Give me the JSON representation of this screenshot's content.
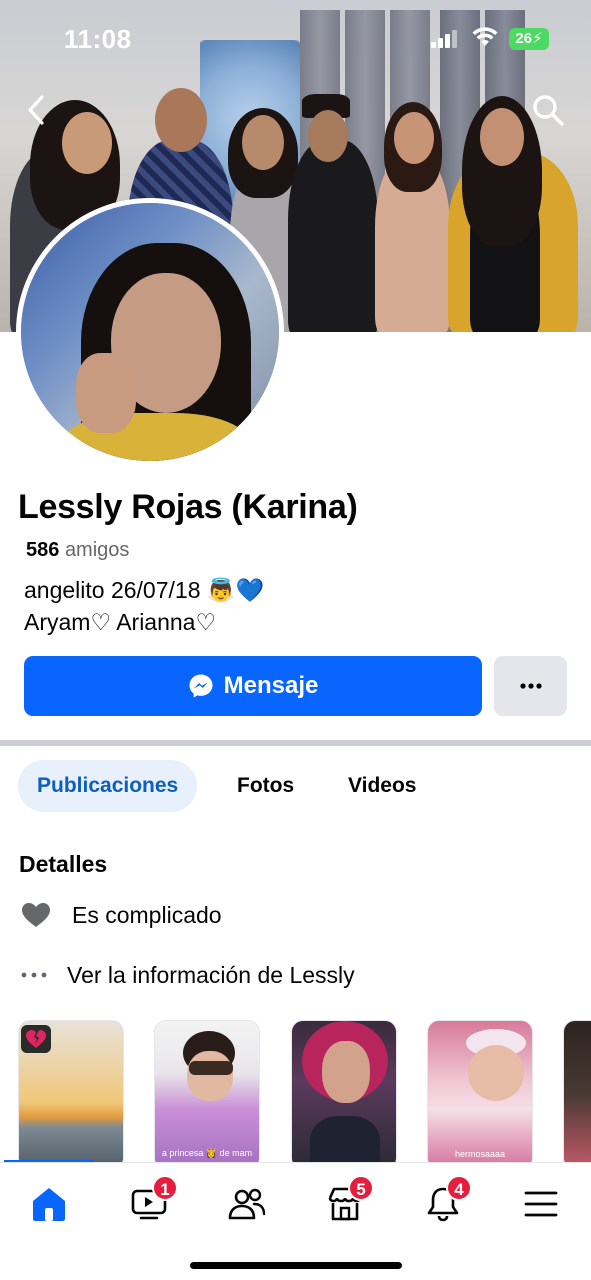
{
  "status_bar": {
    "time": "11:08",
    "battery": "26"
  },
  "header": {
    "back_icon": "chevron-left-icon",
    "search_icon": "search-icon"
  },
  "profile": {
    "name": "Lessly Rojas (Karina)",
    "friends_count": "586",
    "friends_label": "amigos",
    "bio_line1": "angelito 26/07/18 👼💙",
    "bio_line2": "Aryam♡ Arianna♡"
  },
  "actions": {
    "message_label": "Mensaje",
    "message_icon": "messenger-icon",
    "more_label": "···"
  },
  "tabs": [
    {
      "label": "Publicaciones",
      "active": true
    },
    {
      "label": "Fotos",
      "active": false
    },
    {
      "label": "Videos",
      "active": false
    }
  ],
  "details": {
    "title": "Detalles",
    "relationship": "Es complicado",
    "see_info": "Ver la información de Lessly"
  },
  "stories": [
    {
      "caption": ""
    },
    {
      "caption": "a princesa 👸 de mam"
    },
    {
      "caption": ""
    },
    {
      "caption": "hermosaaaa"
    },
    {
      "caption": ""
    }
  ],
  "navbar": {
    "items": [
      {
        "name": "home-icon",
        "badge": ""
      },
      {
        "name": "video-icon",
        "badge": "1"
      },
      {
        "name": "friends-icon",
        "badge": ""
      },
      {
        "name": "marketplace-icon",
        "badge": "5"
      },
      {
        "name": "bell-icon",
        "badge": "4"
      },
      {
        "name": "menu-icon",
        "badge": ""
      }
    ]
  },
  "colors": {
    "accent": "#0866ff",
    "badge": "#e41e3f",
    "tab_active_bg": "#e7f0fb"
  }
}
